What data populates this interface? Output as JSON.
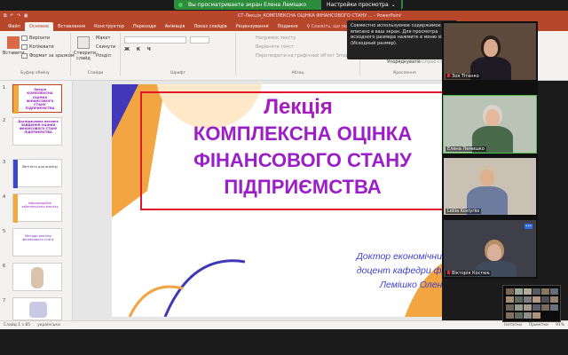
{
  "zoom": {
    "share_text": "Вы просматриваете экран Елена Лемішко",
    "view_options": "Настройки просмотра",
    "chevron": "⌄",
    "tooltip": "Совместно используемое содержимое вписано в ваш экран. Для просмотра исходного размера нажмите в меню size\" (Исходный размер)."
  },
  "powerpoint": {
    "quick_access": "⧉ ↶ ↷ ▣",
    "doc_title": "СТ-Лекція_КОМПЛЕКСНА ОЦІНКА ФІНАНСОВОГО СТАНУ ... - PowerPoint",
    "tabs": [
      "Файл",
      "Основне",
      "Вставлення",
      "Конструктор",
      "Переходи",
      "Анімація",
      "Показ слайдів",
      "Рецензування",
      "Подання"
    ],
    "tell_me": "♀ Скажіть, що потрібно зробити",
    "ribbon": {
      "paste": "Вставити",
      "cut": "Вирізати",
      "copy": "Копіювати",
      "format_painter": "Формат за зразком",
      "clipboard": "Буфер обміну",
      "new_slide": "Створити слайд",
      "layout": "Макет",
      "reset": "Скинути",
      "section": "Розділ",
      "slides": "Слайди",
      "font": "Шрифт",
      "paragraph": "Абзац",
      "text_direction": "Напрямок тексту",
      "align_text": "Вирівняти текст",
      "smartart": "Перетворити на графічний об'єкт SmartArt",
      "arrange": "Упорядкувати",
      "quick_styles": "Експрес-стилі",
      "drawing": "Креслення"
    },
    "thumbnails": [
      {
        "num": "1",
        "text": "Лекція КОМПЛЕКСНА ОЦІНКА ФІНАНСОВОГО СТАНУ ПІДПРИЄМСТВА"
      },
      {
        "num": "2",
        "text": "Досліджувана питання ЗАВДАННЯ ОЦІНКИ ФІНАНСОВОГО СТАНУ ПІДПРИЄМСТВА"
      },
      {
        "num": "3",
        "text": "Звітність для аналізу"
      },
      {
        "num": "4",
        "text": "Інформаційне забезпечення аналізу"
      },
      {
        "num": "5",
        "text": "Методи аналізу фінансового стану"
      },
      {
        "num": "6",
        "text": ""
      },
      {
        "num": "7",
        "text": ""
      }
    ],
    "slide": {
      "lecture": "Лекція",
      "title_lines": [
        "КОМПЛЕКСНА ОЦІНКА",
        "ФІНАНСОВОГО СТАНУ",
        "ПІДПРИЄМСТВА"
      ],
      "author_lines": [
        "Доктор економічних наук,",
        "доцент кафедри фінансів",
        "Лемішко Олена"
      ]
    },
    "status": {
      "slide_num": "Слайд 1 з 85",
      "language": "українська",
      "notes": "Нотатки",
      "comments": "Примітки",
      "zoom": "91%"
    }
  },
  "participants": [
    {
      "name": "Зоя Тітенко",
      "muted": true,
      "speaking": false,
      "bg": "#5c4a3c",
      "hair": "#2a1f1a",
      "face": "#d8a98c",
      "shirt": "#1e1b24"
    },
    {
      "name": "Елена Лемишко",
      "muted": false,
      "speaking": true,
      "bg": "#b9c4b6",
      "hair": "#d9d3cd",
      "face": "#e3b89b",
      "shirt": "#4a6a4c"
    },
    {
      "name": "Lidiia Kostyrko",
      "muted": false,
      "speaking": false,
      "bg": "#c8c1b4",
      "hair": "#cfc1a5",
      "face": "#ddb092",
      "shirt": "#6d7c9e"
    },
    {
      "name": "Вікторія Костюк",
      "muted": true,
      "speaking": false,
      "bg": "#3e3f49",
      "hair": "#b59064",
      "face": "#d9b09a",
      "shirt": "#3f4a5a"
    }
  ],
  "colors": {
    "accent": "#b7472a",
    "title_purple": "#9b1ec8",
    "frame_red": "#e0162b",
    "zoom_green": "#2d8c3c"
  }
}
